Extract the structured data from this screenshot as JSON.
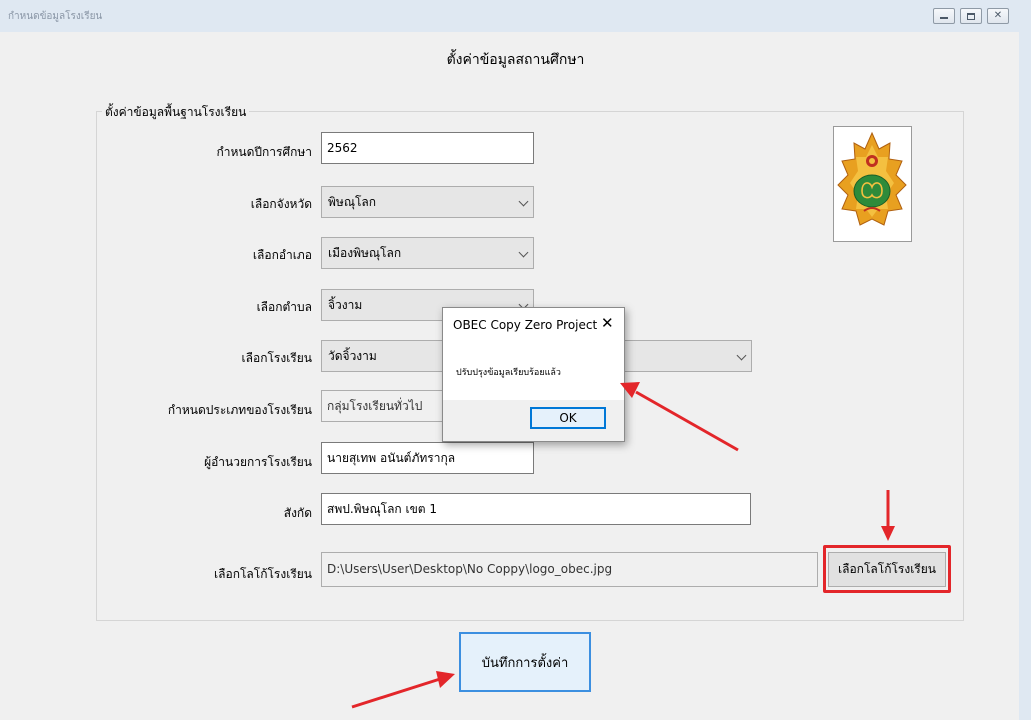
{
  "window": {
    "title": "กำหนดข้อมูลโรงเรียน",
    "controls": [
      "minimize",
      "maximize",
      "close"
    ]
  },
  "page": {
    "heading": "ตั้งค่าข้อมูลสถานศึกษา"
  },
  "group": {
    "legend": "ตั้งค่าข้อมูลพื้นฐานโรงเรียน"
  },
  "form": {
    "academic_year": {
      "label": "กำหนดปีการศึกษา",
      "value": "2562"
    },
    "province": {
      "label": "เลือกจังหวัด",
      "value": "พิษณุโลก"
    },
    "district": {
      "label": "เลือกอำเภอ",
      "value": "เมืองพิษณุโลก"
    },
    "subdistrict": {
      "label": "เลือกตำบล",
      "value": "จิ้วงาม"
    },
    "school": {
      "label": "เลือกโรงเรียน",
      "value": "วัดจิ้วงาม"
    },
    "school_type": {
      "label": "กำหนดประเภทของโรงเรียน",
      "value": "กลุ่มโรงเรียนทั่วไป"
    },
    "director": {
      "label": "ผู้อำนวยการโรงเรียน",
      "value": "นายสุเทพ   อนันต์ภัทรากุล"
    },
    "affiliation": {
      "label": "สังกัด",
      "value": "สพป.พิษณุโลก เขต 1"
    },
    "logo": {
      "label": "เลือกโลโก้โรงเรียน",
      "path": "D:\\Users\\User\\Desktop\\No Coppy\\logo_obec.jpg",
      "button_label": "เลือกโลโก้โรงเรียน"
    }
  },
  "save_button": {
    "label": "บันทึกการตั้งค่า"
  },
  "dialog": {
    "title": "OBEC Copy Zero Project",
    "close": "✕",
    "message": "ปรับปรุงข้อมูลเรียบร้อยแล้ว",
    "ok_label": "OK"
  },
  "colors": {
    "annotation_red": "#e3262a",
    "accent_blue": "#0078d7",
    "logo_orange": "#e8a020",
    "logo_green": "#2e8b3a"
  }
}
